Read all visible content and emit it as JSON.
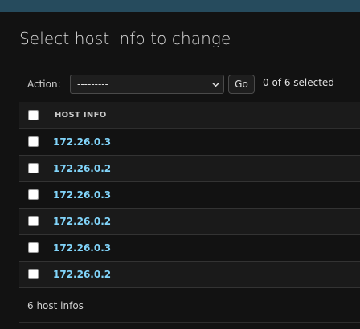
{
  "header": {
    "bar_color": "#264b5d"
  },
  "page": {
    "title": "Select host info to change"
  },
  "actions": {
    "label": "Action:",
    "select_value": "---------",
    "go_label": "Go",
    "selected_text": "0 of 6 selected"
  },
  "table": {
    "column_header": "HOST INFO",
    "rows": [
      {
        "label": "172.26.0.3",
        "checked": false
      },
      {
        "label": "172.26.0.2",
        "checked": false
      },
      {
        "label": "172.26.0.3",
        "checked": false
      },
      {
        "label": "172.26.0.2",
        "checked": false
      },
      {
        "label": "172.26.0.3",
        "checked": false
      },
      {
        "label": "172.26.0.2",
        "checked": false
      }
    ],
    "link_color": "#81d4fa"
  },
  "footer": {
    "count_text": "6 host infos"
  },
  "icons": {
    "select_chevron": "chevron-down-icon",
    "checkbox": "checkbox"
  }
}
